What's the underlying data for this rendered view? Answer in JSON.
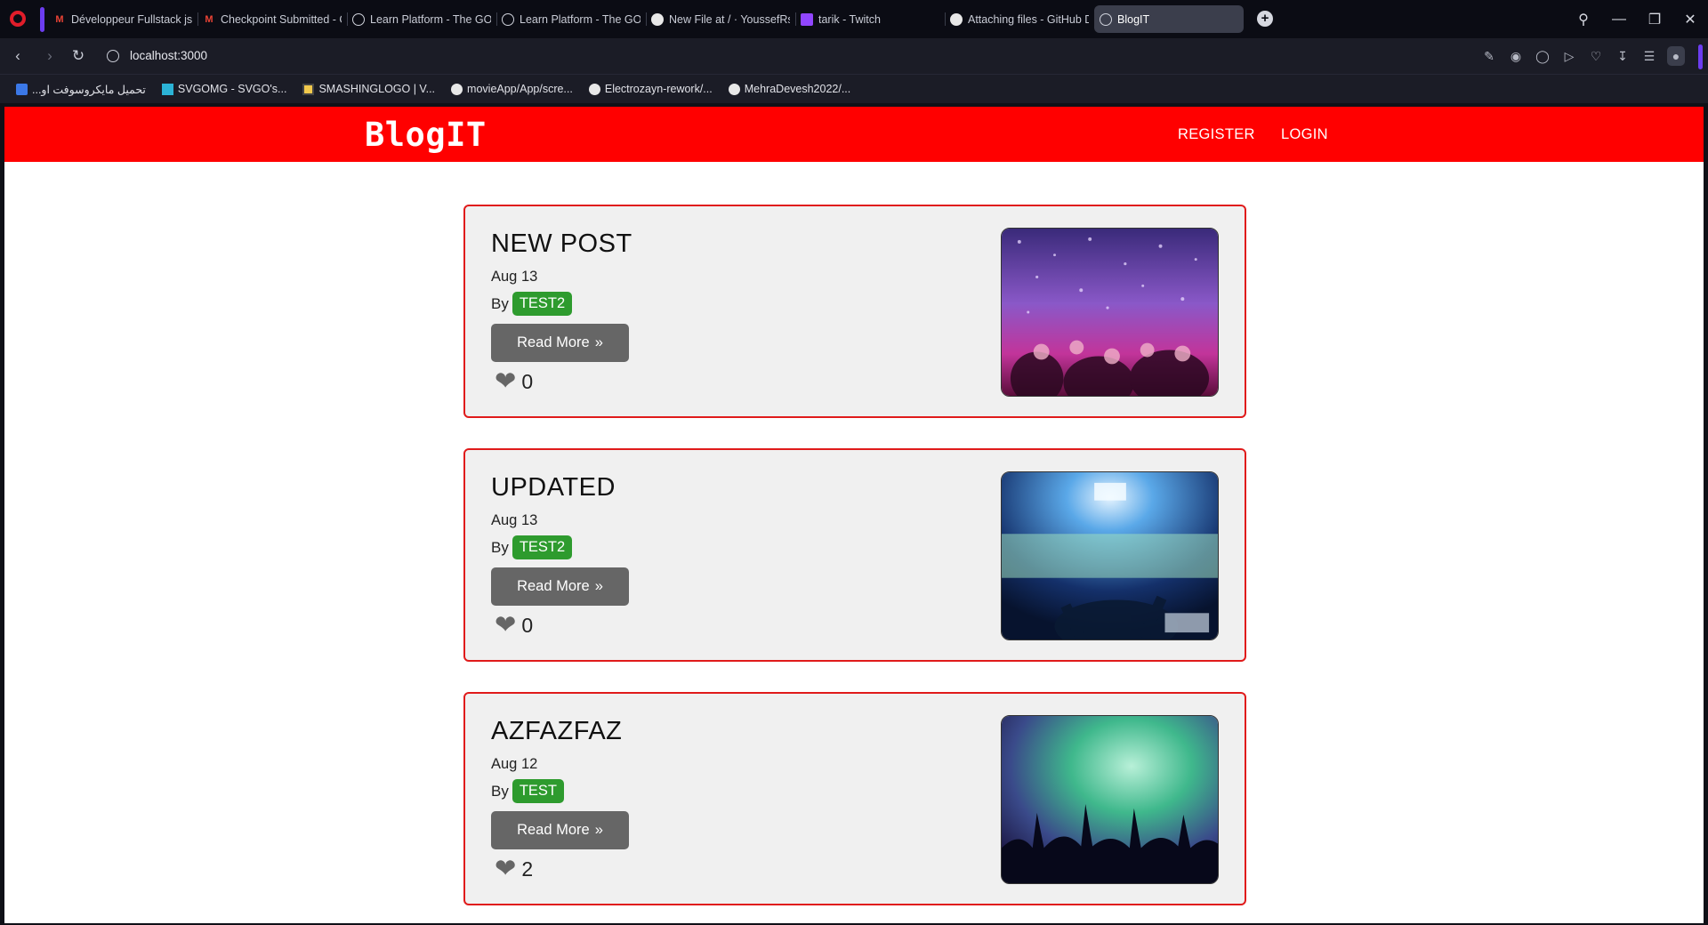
{
  "browser": {
    "tabs": [
      {
        "label": "Développeur Fullstack js -",
        "icon": "gmail-icon"
      },
      {
        "label": "Checkpoint Submitted - C",
        "icon": "gmail-icon"
      },
      {
        "label": "Learn Platform - The GOM",
        "icon": "globe-icon"
      },
      {
        "label": "Learn Platform - The GOM",
        "icon": "globe-icon"
      },
      {
        "label": "New File at / · YoussefRs/I",
        "icon": "github-icon"
      },
      {
        "label": "tarik - Twitch",
        "icon": "twitch-icon"
      },
      {
        "label": "Attaching files - GitHub D",
        "icon": "github-icon"
      },
      {
        "label": "BlogIT",
        "icon": "globe-icon",
        "active": true
      }
    ],
    "url": "localhost:3000",
    "bookmarks": [
      {
        "label": "تحميل مايكروسوفت او...",
        "icon": "office-icon"
      },
      {
        "label": "SVGOMG - SVGO's...",
        "icon": "svgomg-icon"
      },
      {
        "label": "SMASHINGLOGO | V...",
        "icon": "smashinglogo-icon"
      },
      {
        "label": "movieApp/App/scre...",
        "icon": "github-icon"
      },
      {
        "label": "Electrozayn-rework/...",
        "icon": "github-icon"
      },
      {
        "label": "MehraDevesh2022/...",
        "icon": "github-icon"
      }
    ]
  },
  "site": {
    "brand": "BlogIT",
    "nav": {
      "register": "REGISTER",
      "login": "LOGIN"
    },
    "accent_color": "#ff0000"
  },
  "posts": [
    {
      "title": "NEW POST",
      "date": "Aug 13",
      "by": "By",
      "author": "TEST2",
      "read_more": "Read More",
      "likes": "0",
      "image": "confetti-crowd-image"
    },
    {
      "title": "UPDATED",
      "date": "Aug 13",
      "by": "By",
      "author": "TEST2",
      "read_more": "Read More",
      "likes": "0",
      "image": "dj-stadium-image"
    },
    {
      "title": "AZFAZFAZ",
      "date": "Aug 12",
      "by": "By",
      "author": "TEST",
      "read_more": "Read More",
      "likes": "2",
      "image": "green-smoke-crowd-image"
    }
  ]
}
